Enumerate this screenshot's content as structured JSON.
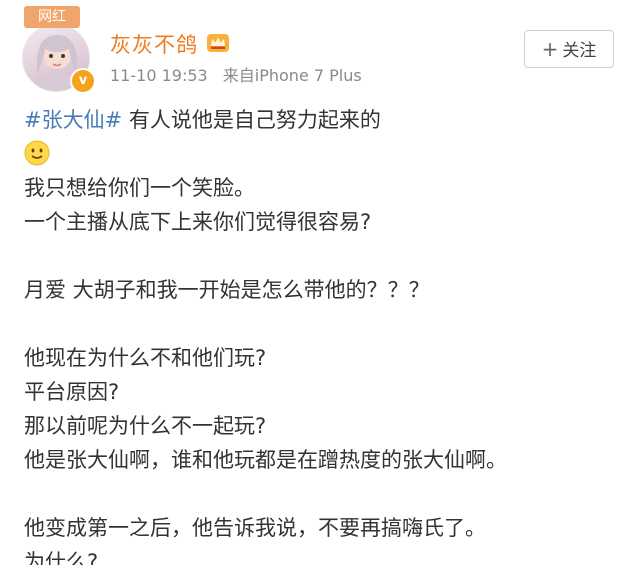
{
  "header": {
    "avatar_badge": "网红",
    "user_name": "灰灰不鸽",
    "verified_mark": "v",
    "timestamp": "11-10 19:53",
    "source": "来自iPhone 7 Plus",
    "follow_label": "关注",
    "follow_plus": "+"
  },
  "post": {
    "hashtag": "#张大仙#",
    "first_line_rest": " 有人说他是自己努力起来的",
    "emoji_icon": "smile-emoji",
    "lines": [
      "我只想给你们一个笑脸。",
      "一个主播从底下上来你们觉得很容易?",
      "",
      "月爱 大胡子和我一开始是怎么带他的？？？",
      "",
      "他现在为什么不和他们玩?",
      "平台原因?",
      "那以前呢为什么不一起玩?",
      "他是张大仙啊，谁和他玩都是在蹭热度的张大仙啊。",
      "",
      "他变成第一之后，他告诉我说，不要再搞嗨氏了。"
    ],
    "partial_line": "为什么?"
  },
  "colors": {
    "username": "#f37b1d",
    "hashtag": "#4a7bb6",
    "text": "#333333",
    "meta": "#8a8a8a"
  }
}
